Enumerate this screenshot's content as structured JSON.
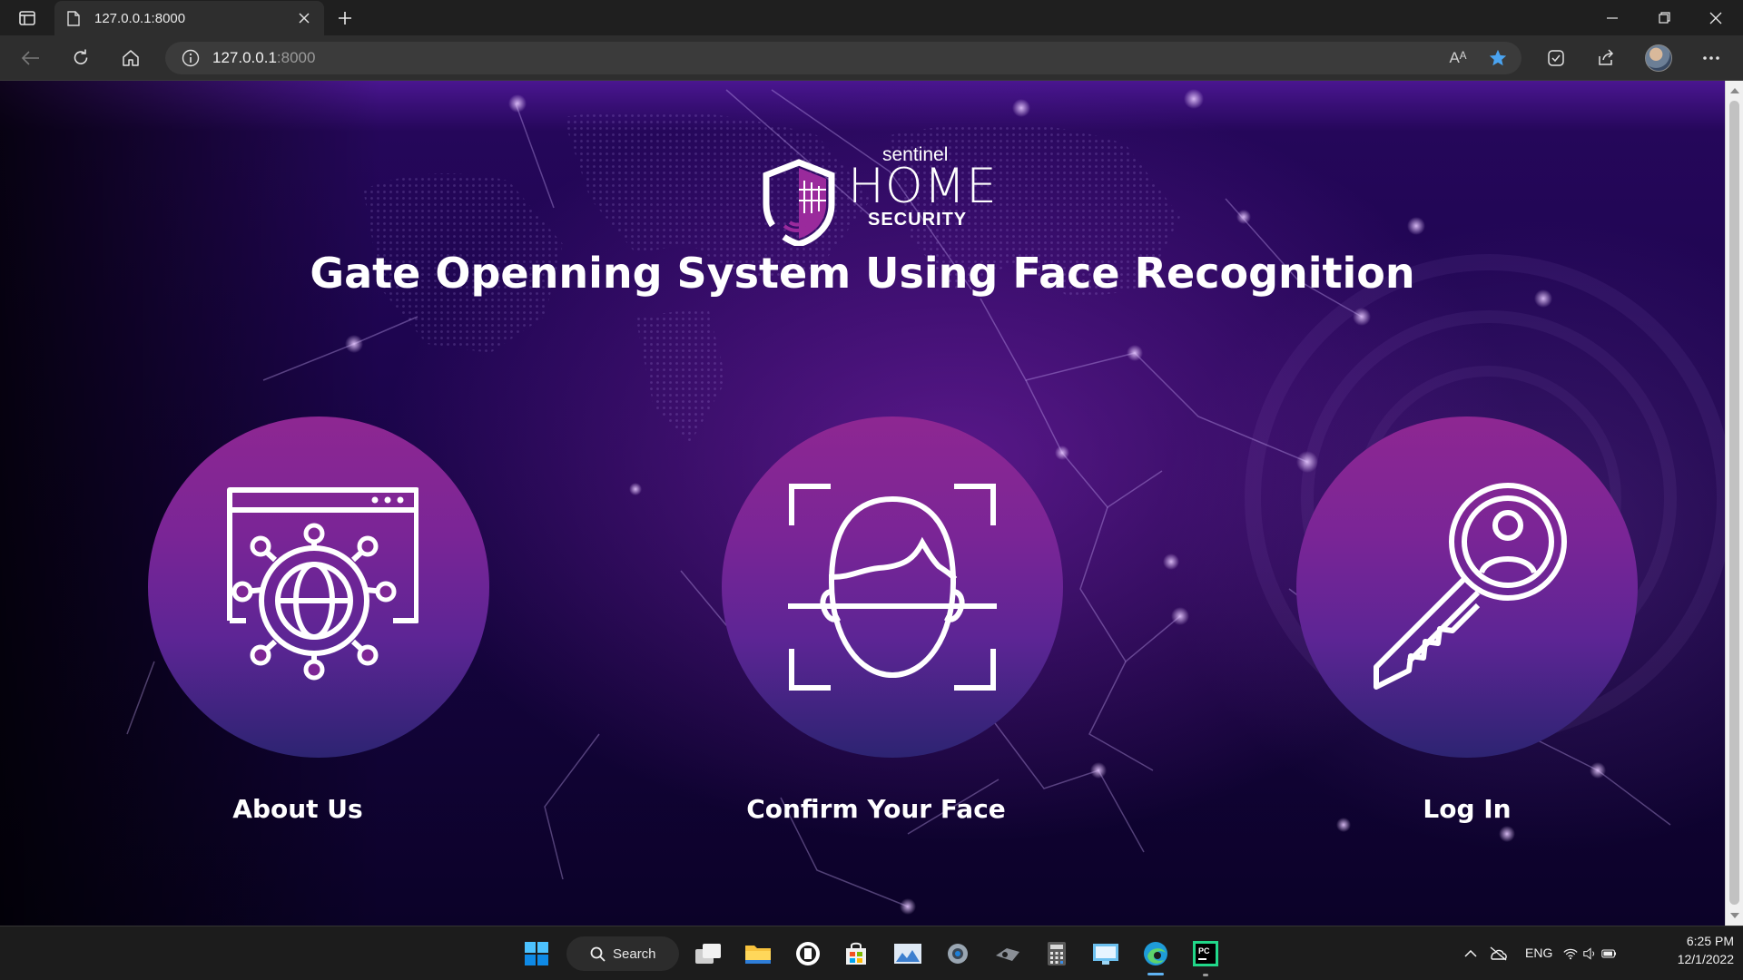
{
  "browser": {
    "tab_title": "127.0.0.1:8000",
    "url_host": "127.0.0.1",
    "url_port": ":8000",
    "read_aloud_label": "Aᴬ"
  },
  "page": {
    "logo": {
      "line1": "sentinel",
      "line2": "HOME",
      "line3": "SECURITY"
    },
    "headline": "Gate Openning System Using Face Recognition",
    "features": [
      {
        "label": "About Us",
        "icon": "globe-network-window-icon"
      },
      {
        "label": "Confirm Your Face",
        "icon": "face-scan-icon"
      },
      {
        "label": "Log In",
        "icon": "user-key-icon"
      }
    ],
    "colors": {
      "circle_top": "#8e2792",
      "circle_bottom": "#2d2472",
      "background": "#1e0550"
    }
  },
  "taskbar": {
    "search_label": "Search",
    "language": "ENG",
    "time": "6:25 PM",
    "date": "12/1/2022"
  }
}
